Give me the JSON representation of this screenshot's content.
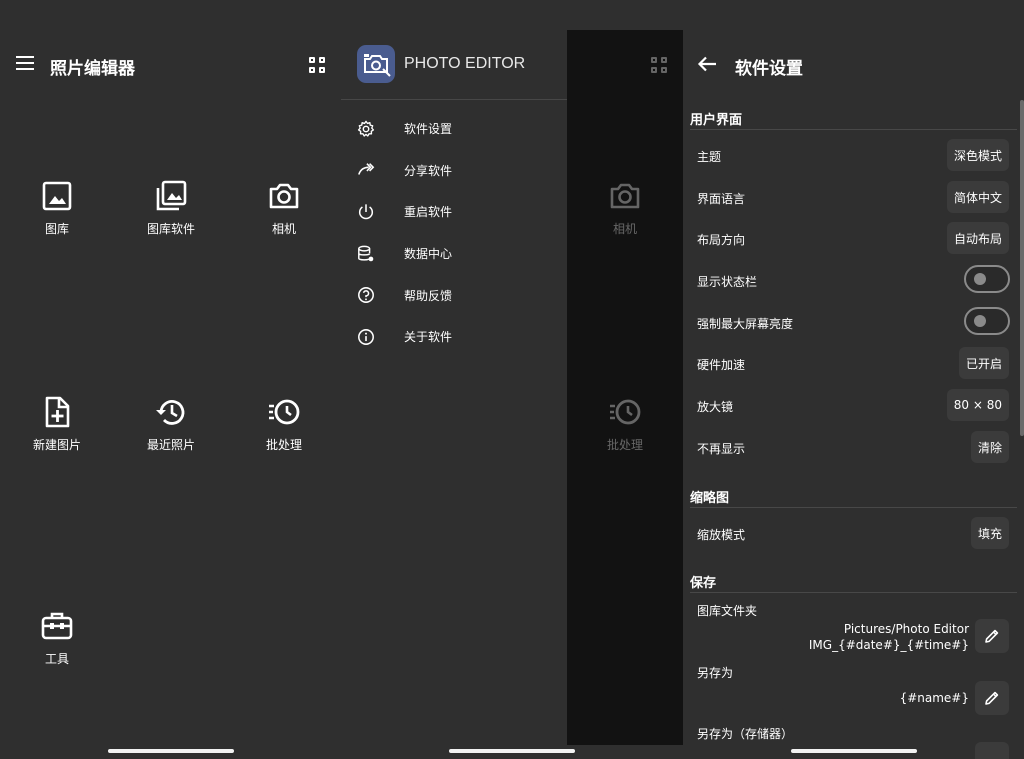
{
  "home": {
    "title": "照片编辑器",
    "tiles": [
      {
        "label": "图库",
        "icon": "image-icon"
      },
      {
        "label": "图库软件",
        "icon": "gallery-icon"
      },
      {
        "label": "相机",
        "icon": "camera-icon"
      },
      {
        "label": "新建图片",
        "icon": "new-file-icon"
      },
      {
        "label": "最近照片",
        "icon": "history-icon"
      },
      {
        "label": "批处理",
        "icon": "batch-icon"
      },
      {
        "label": "工具",
        "icon": "toolbox-icon"
      }
    ]
  },
  "drawer": {
    "app_name": "PHOTO EDITOR",
    "items": [
      {
        "label": "软件设置",
        "icon": "gear-icon"
      },
      {
        "label": "分享软件",
        "icon": "share-icon"
      },
      {
        "label": "重启软件",
        "icon": "power-icon"
      },
      {
        "label": "数据中心",
        "icon": "database-icon"
      },
      {
        "label": "帮助反馈",
        "icon": "help-icon"
      },
      {
        "label": "关于软件",
        "icon": "info-icon"
      }
    ],
    "behind_tiles": [
      {
        "label": "相机"
      },
      {
        "label": "批处理"
      }
    ]
  },
  "settings": {
    "title": "软件设置",
    "sections": {
      "ui": "用户界面",
      "thumbnail": "缩略图",
      "save": "保存"
    },
    "rows": {
      "theme": {
        "label": "主题",
        "value": "深色模式"
      },
      "language": {
        "label": "界面语言",
        "value": "简体中文"
      },
      "layout": {
        "label": "布局方向",
        "value": "自动布局"
      },
      "statusbar": {
        "label": "显示状态栏",
        "on": false
      },
      "brightness": {
        "label": "强制最大屏幕亮度",
        "on": false
      },
      "hwaccel": {
        "label": "硬件加速",
        "value": "已开启"
      },
      "magnifier": {
        "label": "放大镜",
        "value": "80 × 80"
      },
      "dontshow": {
        "label": "不再显示",
        "value": "清除"
      },
      "scale": {
        "label": "缩放模式",
        "value": "填充"
      },
      "folder": {
        "label": "图库文件夹",
        "path": "Pictures/Photo Editor",
        "pattern": "IMG_{#date#}_{#time#}"
      },
      "saveas": {
        "label": "另存为",
        "pattern": "{#name#}"
      },
      "saveas_storage": {
        "label": "另存为（存储器）"
      }
    }
  }
}
